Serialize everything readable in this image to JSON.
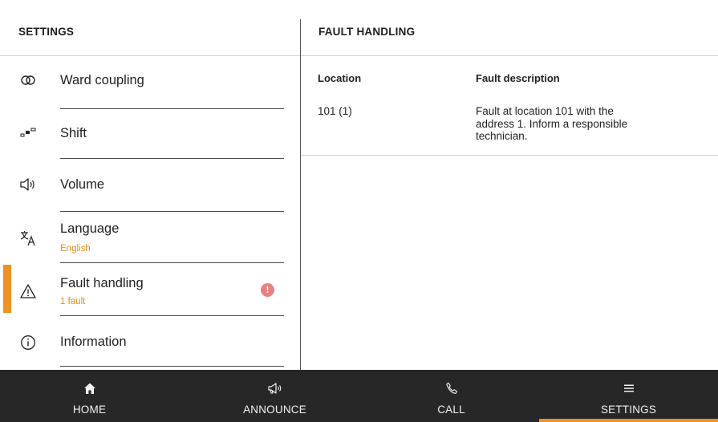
{
  "left_panel": {
    "title": "SETTINGS"
  },
  "right_panel": {
    "title": "FAULT HANDLING"
  },
  "menu": {
    "items": [
      {
        "label": "Ward coupling",
        "sub": "",
        "icon": "link-icon"
      },
      {
        "label": "Shift",
        "sub": "",
        "icon": "shift-icon"
      },
      {
        "label": "Volume",
        "sub": "",
        "icon": "speaker-icon"
      },
      {
        "label": "Language",
        "sub": "English",
        "icon": "translate-icon"
      },
      {
        "label": "Fault handling",
        "sub": "1 fault",
        "icon": "warning-icon",
        "active": true,
        "alert": "!"
      },
      {
        "label": "Information",
        "sub": "",
        "icon": "info-icon"
      }
    ]
  },
  "fault_table": {
    "headers": {
      "location": "Location",
      "description": "Fault description"
    },
    "rows": [
      {
        "location": "101 (1)",
        "description": "Fault at location 101 with the address 1. Inform a responsible technician."
      }
    ]
  },
  "bottom_nav": {
    "items": [
      {
        "label": "HOME",
        "icon": "home-icon"
      },
      {
        "label": "ANNOUNCE",
        "icon": "megaphone-icon"
      },
      {
        "label": "CALL",
        "icon": "phone-icon"
      },
      {
        "label": "SETTINGS",
        "icon": "menu-icon",
        "active": true
      }
    ]
  },
  "colors": {
    "accent": "#f0901e",
    "alert": "#ec7f7f",
    "nav_bg": "#272727"
  }
}
